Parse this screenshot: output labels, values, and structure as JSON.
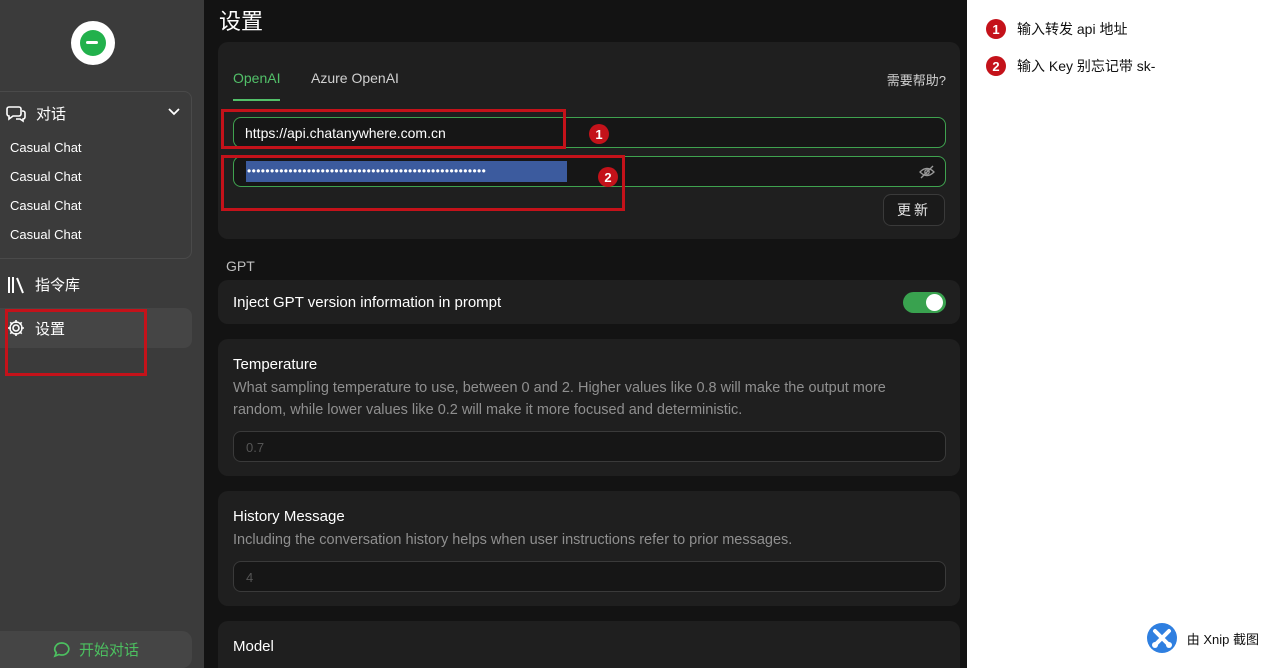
{
  "sidebar": {
    "chat_label": "对话",
    "chats": [
      "Casual Chat",
      "Casual Chat",
      "Casual Chat",
      "Casual Chat"
    ],
    "library_label": "指令库",
    "settings_label": "设置",
    "start_chat_label": "开始对话"
  },
  "main": {
    "title": "设置",
    "tabs": [
      "OpenAI",
      "Azure OpenAI"
    ],
    "active_tab": "OpenAI",
    "help_label": "需要帮助?",
    "api_url": "https://api.chatanywhere.com.cn",
    "api_key_masked": "••••••••••••••••••••••••••••••••••••••••••••••••••••",
    "update_label": "更新",
    "gpt_section": "GPT",
    "inject_label": "Inject GPT version information in prompt",
    "inject_enabled": true,
    "temperature": {
      "title": "Temperature",
      "description": "What sampling temperature to use, between 0 and 2. Higher values like 0.8 will make the output more random, while lower values like 0.2 will make it more focused and deterministic.",
      "placeholder": "0.7"
    },
    "history": {
      "title": "History Message",
      "description": "Including the conversation history helps when user instructions refer to prior messages.",
      "placeholder": "4"
    },
    "model": {
      "title": "Model"
    }
  },
  "annotations": {
    "badge1": "1",
    "badge2": "2",
    "note1": "输入转发 api 地址",
    "note2": "输入 Key 别忘记带 sk-"
  },
  "watermark": "由 Xnip 截图",
  "colors": {
    "accent_green": "#52c069",
    "annotation_red": "#c4121a",
    "key_highlight": "#3c5b9e"
  }
}
